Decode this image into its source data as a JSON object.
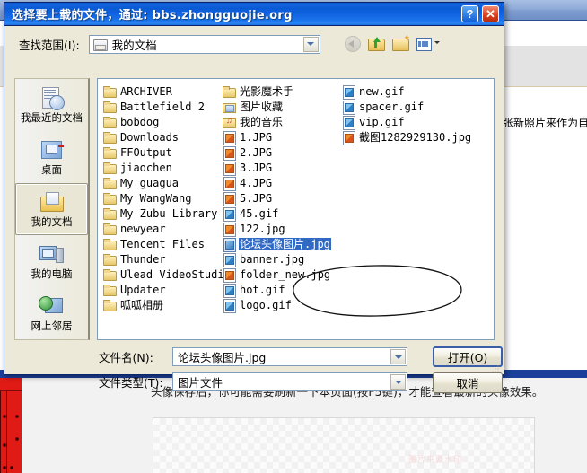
{
  "background": {
    "right_text": "张新照片来作为自",
    "hint_text": "头像保存后，你可能需要刷新一下本页面(按F5键)，才能查看最新的头像效果。",
    "watermark": "图片来源水印"
  },
  "dialog": {
    "title": "选择要上载的文件，通过: bbs.zhongguojie.org",
    "help_button": "?",
    "close_button": "✕",
    "lookin": {
      "label": "查找范围(I):",
      "value": "我的文档"
    },
    "toolbar": {
      "back": "back-icon",
      "up": "up-one-level-icon",
      "new_folder": "new-folder-icon",
      "views": "views-icon"
    },
    "places": [
      {
        "label": "我最近的文档",
        "icon": "recent-documents-icon",
        "selected": false
      },
      {
        "label": "桌面",
        "icon": "desktop-icon",
        "selected": false
      },
      {
        "label": "我的文档",
        "icon": "my-documents-icon",
        "selected": true
      },
      {
        "label": "我的电脑",
        "icon": "my-computer-icon",
        "selected": false
      },
      {
        "label": "网上邻居",
        "icon": "network-neighborhood-icon",
        "selected": false
      }
    ],
    "filelist": {
      "columns": [
        {
          "items": [
            {
              "name": "ARCHIVER",
              "icon": "folder-icon",
              "selected": false
            },
            {
              "name": "Battlefield 2",
              "icon": "folder-icon",
              "selected": false
            },
            {
              "name": "bobdog",
              "icon": "folder-icon",
              "selected": false
            },
            {
              "name": "Downloads",
              "icon": "folder-icon",
              "selected": false
            },
            {
              "name": "FFOutput",
              "icon": "folder-icon",
              "selected": false
            },
            {
              "name": "jiaochen",
              "icon": "folder-icon",
              "selected": false
            },
            {
              "name": "My guagua",
              "icon": "folder-icon",
              "selected": false
            },
            {
              "name": "My WangWang",
              "icon": "folder-icon",
              "selected": false
            },
            {
              "name": "My Zubu Library",
              "icon": "folder-icon",
              "selected": false
            },
            {
              "name": "newyear",
              "icon": "folder-icon",
              "selected": false
            },
            {
              "name": "Tencent Files",
              "icon": "folder-icon",
              "selected": false
            },
            {
              "name": "Thunder",
              "icon": "folder-icon",
              "selected": false
            },
            {
              "name": "Ulead VideoStudio",
              "icon": "folder-icon",
              "selected": false
            },
            {
              "name": "Updater",
              "icon": "folder-icon",
              "selected": false
            },
            {
              "name": "呱呱相册",
              "icon": "folder-icon",
              "selected": false
            }
          ]
        },
        {
          "items": [
            {
              "name": "光影魔术手",
              "icon": "folder-icon",
              "selected": false
            },
            {
              "name": "图片收藏",
              "icon": "pictures-folder-icon",
              "selected": false
            },
            {
              "name": "我的音乐",
              "icon": "music-folder-icon",
              "selected": false
            },
            {
              "name": "1.JPG",
              "icon": "jpg-file-icon",
              "selected": false
            },
            {
              "name": "2.JPG",
              "icon": "jpg-file-icon",
              "selected": false
            },
            {
              "name": "3.JPG",
              "icon": "jpg-file-icon",
              "selected": false
            },
            {
              "name": "4.JPG",
              "icon": "jpg-file-icon",
              "selected": false
            },
            {
              "name": "5.JPG",
              "icon": "jpg-file-icon",
              "selected": false
            },
            {
              "name": "45.gif",
              "icon": "gif-file-icon",
              "selected": false
            },
            {
              "name": "122.jpg",
              "icon": "jpg-file-icon",
              "selected": false
            },
            {
              "name": "论坛头像图片.jpg",
              "icon": "selected-file-icon",
              "selected": true
            },
            {
              "name": "banner.jpg",
              "icon": "gif-file-icon",
              "selected": false
            },
            {
              "name": "folder_new.jpg",
              "icon": "jpg-file-icon",
              "selected": false
            },
            {
              "name": "hot.gif",
              "icon": "gif-file-icon",
              "selected": false
            },
            {
              "name": "logo.gif",
              "icon": "gif-file-icon",
              "selected": false
            }
          ]
        },
        {
          "items": [
            {
              "name": "new.gif",
              "icon": "gif-file-icon",
              "selected": false
            },
            {
              "name": "spacer.gif",
              "icon": "gif-file-icon",
              "selected": false
            },
            {
              "name": "vip.gif",
              "icon": "gif-file-icon",
              "selected": false
            },
            {
              "name": "截图1282929130.jpg",
              "icon": "jpg-file-icon",
              "selected": false
            }
          ]
        }
      ]
    },
    "fields": {
      "filename_label": "文件名(N):",
      "filename_value": "论坛头像图片.jpg",
      "filetype_label": "文件类型(T):",
      "filetype_value": "图片文件"
    },
    "buttons": {
      "open": "打开(O)",
      "cancel": "取消"
    }
  },
  "colors": {
    "titlebar_blue": "#0a5ad4",
    "selection_blue": "#316ac5",
    "dialog_face": "#ece9d8",
    "accent_red": "#e01b16"
  }
}
